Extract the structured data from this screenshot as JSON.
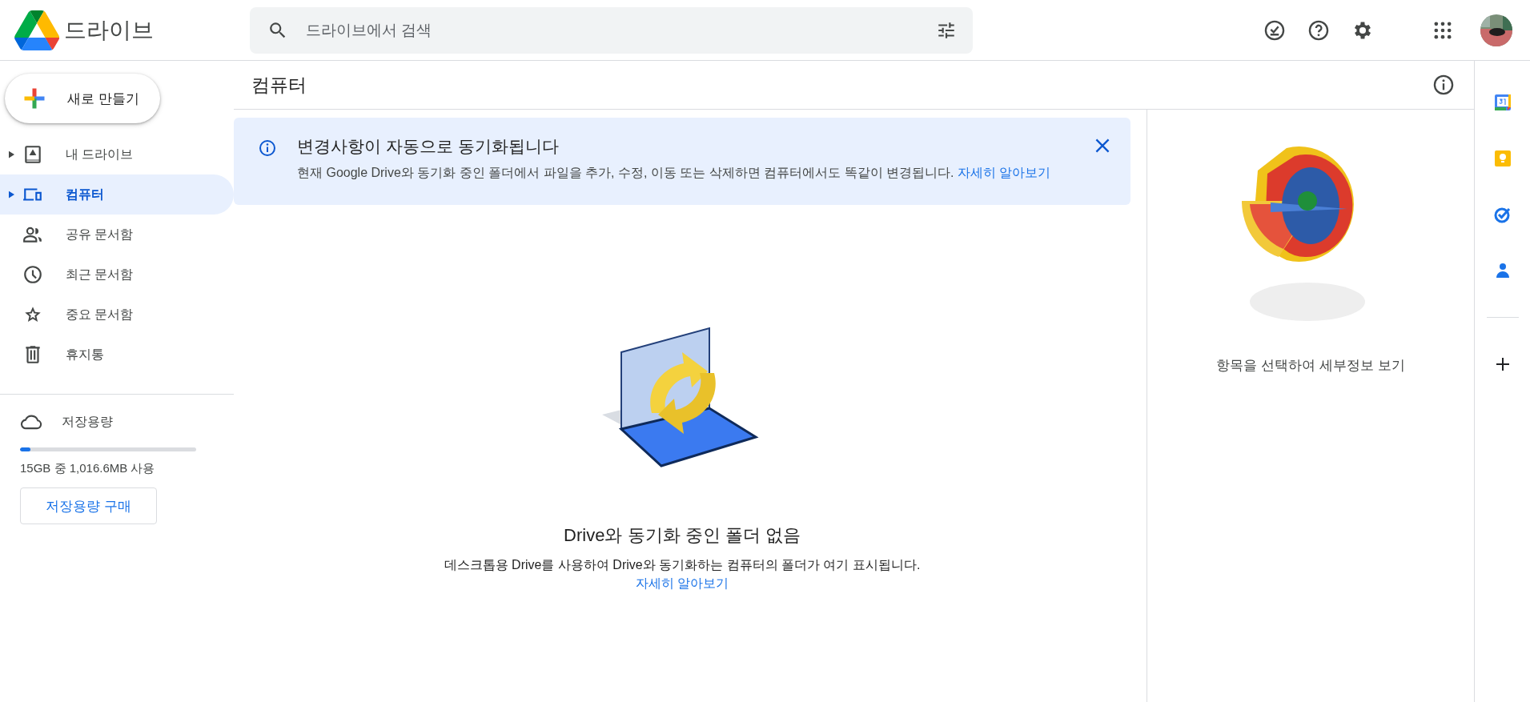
{
  "header": {
    "app_name": "드라이브",
    "search": {
      "placeholder": "드라이브에서 검색"
    }
  },
  "sidebar": {
    "new_button": "새로 만들기",
    "items": [
      {
        "label": "내 드라이브",
        "kind": "drive",
        "expandable": true,
        "selected": false
      },
      {
        "label": "컴퓨터",
        "kind": "computer",
        "expandable": true,
        "selected": true
      },
      {
        "label": "공유 문서함",
        "kind": "people",
        "expandable": false,
        "selected": false
      },
      {
        "label": "최근 문서함",
        "kind": "clock",
        "expandable": false,
        "selected": false
      },
      {
        "label": "중요 문서함",
        "kind": "star",
        "expandable": false,
        "selected": false
      },
      {
        "label": "휴지통",
        "kind": "trash",
        "expandable": false,
        "selected": false
      }
    ],
    "storage": {
      "label": "저장용량",
      "level": 0.06,
      "usage": "15GB 중 1,016.6MB 사용",
      "buy_button": "저장용량 구매"
    }
  },
  "main": {
    "title": "컴퓨터",
    "banner": {
      "title": "변경사항이 자동으로 동기화됩니다",
      "text": "현재 Google Drive와 동기화 중인 폴더에서 파일을 추가, 수정, 이동 또는 삭제하면 컴퓨터에서도 똑같이 변경됩니다.",
      "link": "자세히 알아보기"
    },
    "empty": {
      "title": "Drive와 동기화 중인 폴더 없음",
      "text": "데스크톱용 Drive를 사용하여 Drive와 동기화하는 컴퓨터의 폴더가 여기 표시됩니다.",
      "link": "자세히 알아보기"
    }
  },
  "details": {
    "text": "항목을 선택하여 세부정보 보기"
  }
}
